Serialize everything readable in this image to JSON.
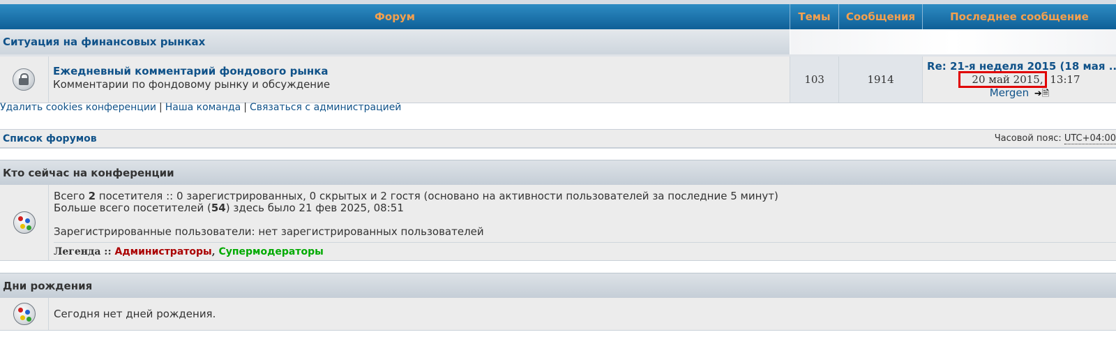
{
  "table_header": {
    "forum": "Форум",
    "topics": "Темы",
    "posts": "Сообщения",
    "last_post": "Последнее сообщение"
  },
  "category": {
    "title": "Ситуация на финансовых рынках"
  },
  "forum": {
    "title": "Ежедневный комментарий фондового рынка",
    "description": "Комментарии по фондовому рынку и обсуждение",
    "topics": "103",
    "posts": "1914",
    "last_post": {
      "title": "Re: 21-я неделя 2015 (18 мая ...",
      "date": "20 май 2015,",
      "time": " 13:17",
      "author": "Mergen"
    }
  },
  "footer_links": {
    "delete_cookies": "Удалить cookies конференции",
    "team": "Наша команда",
    "contact": "Связаться с администрацией",
    "separator": "|"
  },
  "navbar": {
    "forum_list": "Список форумов",
    "timezone_label": "Часовой пояс: ",
    "timezone_value": "UTC+04:00"
  },
  "online": {
    "header": "Кто сейчас на конференции",
    "total_prefix": "Всего ",
    "total_count": "2",
    "total_suffix": " посетителя :: 0 зарегистрированных, 0 скрытых и 2 гостя (основано на активности пользователей за последние 5 минут)",
    "record_prefix": "Больше всего посетителей (",
    "record_count": "54",
    "record_suffix": ") здесь было 21 фев 2025, 08:51",
    "registered": "Зарегистрированные пользователи: нет зарегистрированных пользователей",
    "legend_label": "Легенда :: ",
    "legend_admins": "Администраторы",
    "legend_comma": ", ",
    "legend_smods": "Супермодераторы"
  },
  "birthdays": {
    "header": "Дни рождения",
    "text": "Сегодня нет дней рождения."
  },
  "colors": {
    "header_blue": "#0e5f97",
    "header_text": "#f5a04d",
    "link": "#105289",
    "highlight": "#e00000",
    "admin": "#aa0000",
    "supermod": "#00aa00"
  },
  "icons": {
    "forum_status": "lock-icon",
    "go_to_post": "go-to-post-icon",
    "online_users": "users-icon",
    "birthdays": "users-icon"
  }
}
